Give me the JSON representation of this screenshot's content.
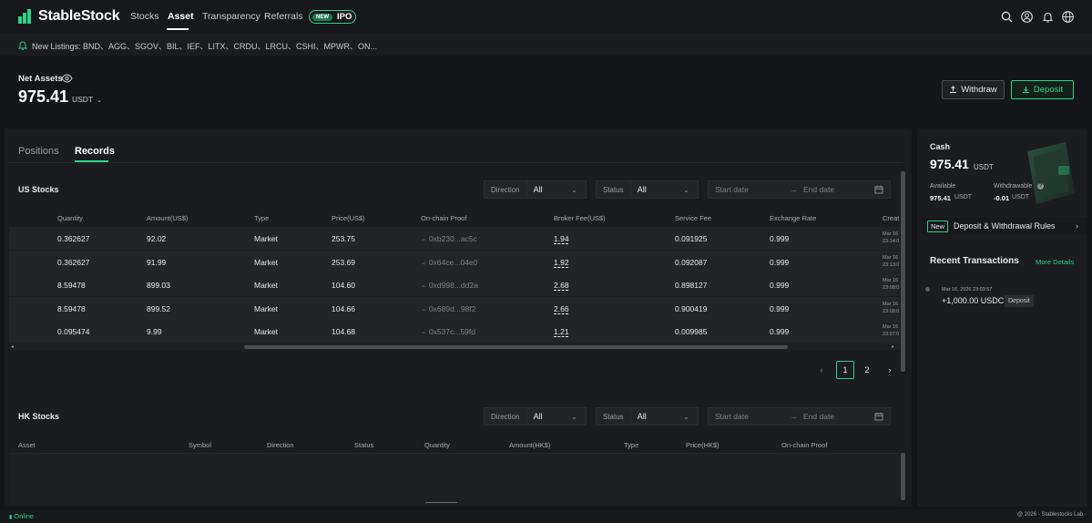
{
  "brand": {
    "name": "StableStock",
    "accent": "#2bd486"
  },
  "nav": {
    "items": [
      {
        "label": "Stocks"
      },
      {
        "label": "Asset"
      },
      {
        "label": "Transparency"
      },
      {
        "label": "Referrals"
      }
    ],
    "ipo_badge": {
      "new": "NEW",
      "label": "IPO"
    },
    "icons": [
      "search-icon",
      "user-icon",
      "bell-icon",
      "globe-icon"
    ]
  },
  "ticker": {
    "text": "New Listings: BND、AGG、SGOV、BIL、IEF、LITX、CRDU、LRCU、CSHI、MPWR、ON..."
  },
  "net_assets": {
    "label": "Net Assets",
    "value": "975.41",
    "unit": "USDT"
  },
  "actions": {
    "withdraw": "Withdraw",
    "deposit": "Deposit"
  },
  "tabs": [
    {
      "label": "Positions"
    },
    {
      "label": "Records"
    }
  ],
  "us_stocks": {
    "title": "US Stocks",
    "filters": {
      "direction_label": "Direction",
      "direction_value": "All",
      "status_label": "Status",
      "status_value": "All",
      "start_placeholder": "Start date",
      "end_placeholder": "End date"
    },
    "columns": [
      "Quantity",
      "Amount(US$)",
      "Type",
      "Price(US$)",
      "On-chain Proof",
      "Broker Fee(US$)",
      "Service Fee",
      "Exchange Rate",
      "Creat"
    ],
    "rows": [
      {
        "quantity": "0.362627",
        "amount": "92.02",
        "type": "Market",
        "price": "253.75",
        "proof": "0xb230...ac5c",
        "broker_fee": "1.94",
        "service_fee": "0.091925",
        "rate": "0.999",
        "created_1": "Mar 16",
        "created_2": "23:14:0"
      },
      {
        "quantity": "0.362627",
        "amount": "91.99",
        "type": "Market",
        "price": "253.69",
        "proof": "0x64ce...04e0",
        "broker_fee": "1.92",
        "service_fee": "0.092087",
        "rate": "0.999",
        "created_1": "Mar 16",
        "created_2": "23:13:0"
      },
      {
        "quantity": "8.59478",
        "amount": "899.03",
        "type": "Market",
        "price": "104.60",
        "proof": "0xd998...dd2a",
        "broker_fee": "2.68",
        "service_fee": "0.898127",
        "rate": "0.999",
        "created_1": "Mar 16",
        "created_2": "23:08:0"
      },
      {
        "quantity": "8.59478",
        "amount": "899.52",
        "type": "Market",
        "price": "104.66",
        "proof": "0x689d...98f2",
        "broker_fee": "2.66",
        "service_fee": "0.900419",
        "rate": "0.999",
        "created_1": "Mar 16",
        "created_2": "23:08:0"
      },
      {
        "quantity": "0.095474",
        "amount": "9.99",
        "type": "Market",
        "price": "104.68",
        "proof": "0x537c...59fd",
        "broker_fee": "1.21",
        "service_fee": "0.009985",
        "rate": "0.999",
        "created_1": "Mar 16",
        "created_2": "23:07:0"
      }
    ],
    "pagination": {
      "pages": [
        "1",
        "2"
      ],
      "current": "1"
    }
  },
  "hk_stocks": {
    "title": "HK Stocks",
    "filters": {
      "direction_label": "Direction",
      "direction_value": "All",
      "status_label": "Status",
      "status_value": "All",
      "start_placeholder": "Start date",
      "end_placeholder": "End date"
    },
    "columns": [
      "Asset",
      "Symbol",
      "Direction",
      "Status",
      "Quantity",
      "Amount(HK$)",
      "Type",
      "Price(HK$)",
      "On-chain Proof"
    ]
  },
  "cash": {
    "label": "Cash",
    "value": "975.41",
    "unit": "USDT",
    "available_label": "Available",
    "available_value": "975.41",
    "available_unit": "USDT",
    "withdrawable_label": "Withdrawable",
    "withdrawable_value": "-0.01",
    "withdrawable_unit": "USDT"
  },
  "rules": {
    "new_tag": "New",
    "label": "Deposit & Withdrawal Rules"
  },
  "recent": {
    "title": "Recent Transactions",
    "more": "More Details",
    "items": [
      {
        "date": "Mar 16, 2026 23:03:57",
        "amount": "+1,000.00 USDC",
        "type": "Deposit"
      }
    ]
  },
  "footer": {
    "status": "Online",
    "copyright": "@ 2026 - Stablestocks Lab"
  }
}
